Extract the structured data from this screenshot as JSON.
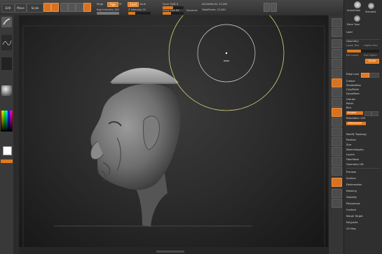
{
  "topbar": {
    "tabs": [
      "Edit",
      "Move",
      "Scale",
      "Rotate"
    ],
    "mrgb_label": "Mrgb",
    "rgb_label": "Rgb",
    "m_label": "M",
    "zadd_label": "Zadd",
    "zsub_label": "Zsub",
    "rgb_intensity_label": "Rgb Intensity 100",
    "z_intensity_label": "Z Intensity 25",
    "focal_shift_label": "Focal Shift 0",
    "draw_size_label": "Draw Size 64",
    "dynamic_label": "Dynamic",
    "active_points_label": "ActivePoints: 22,081",
    "total_points_label": "TotalPoints: 22,081",
    "edit_indicator": "Edit",
    "draw_indicator": "Draw",
    "move_indicator": "Move"
  },
  "tray": {
    "brush_names": [
      "SnakeHook",
      "Standard",
      "Move Topo"
    ],
    "section_title": "Load",
    "items": [
      "Geometry",
      "Lower Res",
      "Higher Res",
      "Divide",
      "Del Lower",
      "Del Higher",
      "Edge Loop",
      "Crease",
      "ShadowBox",
      "ClayPolish",
      "DynaMesh",
      "Groups",
      "Polish",
      "Blur",
      "Project",
      "Resolution 128",
      "ZRemesher",
      "Modify Topology",
      "Position",
      "Size",
      "MeshIntegrity",
      "Layers",
      "FiberMesh",
      "Geometry HD",
      "Preview",
      "Surface",
      "Deformation",
      "Masking",
      "Visibility",
      "Polygroups",
      "Contact",
      "Morph Target",
      "Polypaint",
      "UV Map"
    ]
  },
  "colors": {
    "accent": "#e07a1f",
    "ui_bg": "#2f2f2f",
    "canvas_center": "#3c3c3c",
    "canvas_edge": "#151515",
    "brush_ring": "#d8d47a"
  },
  "icons": {
    "left_shelf": [
      "brush-icon",
      "stroke-icon",
      "alpha-icon",
      "material-icon",
      "color-picker-icon"
    ],
    "right_shelf": [
      "bpr-icon",
      "spix-icon",
      "scroll-icon",
      "zoom-icon",
      "actual-icon",
      "aahalf-icon",
      "persp-icon",
      "floor-icon",
      "local-icon",
      "xyz-icon",
      "frame-icon",
      "move-icon",
      "scale-icon",
      "rotate-icon",
      "polyf-icon",
      "transp-icon",
      "ghost-icon",
      "solo-icon",
      "xpose-icon"
    ]
  }
}
